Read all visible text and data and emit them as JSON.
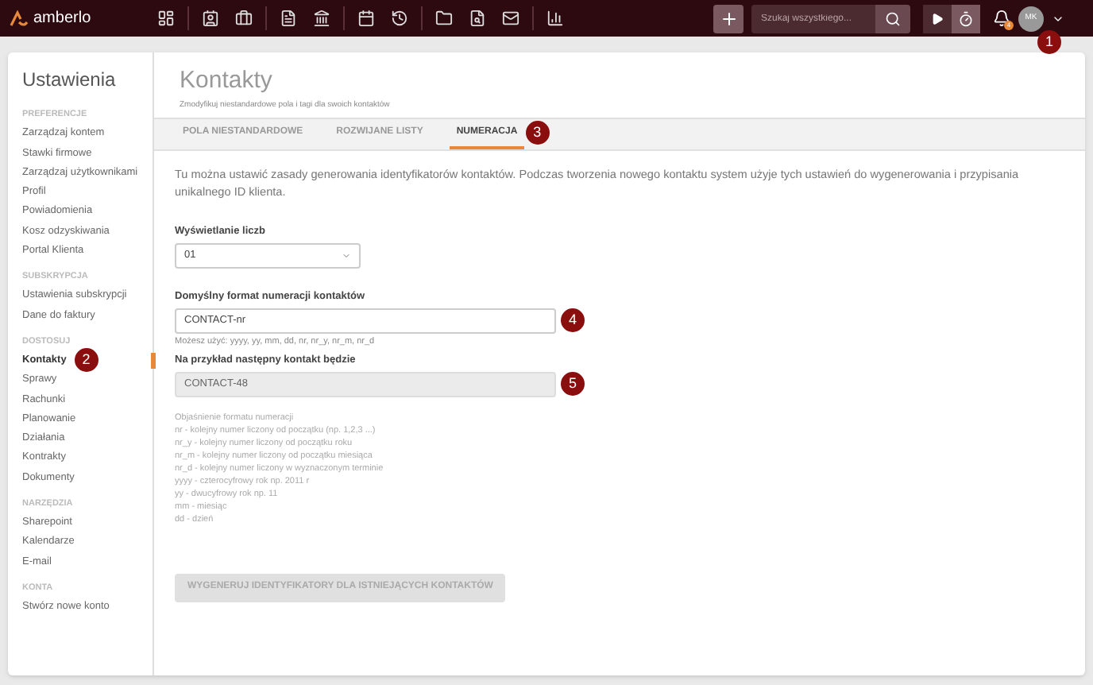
{
  "topbar": {
    "logo": "amberlo",
    "search": {
      "placeholder": "Szukaj wszystkiego..."
    },
    "notifications": "4",
    "avatar": "MK",
    "marker": "1"
  },
  "sidebar": {
    "title": "Ustawienia",
    "sections": [
      {
        "heading": "PREFERENCJE",
        "items": [
          {
            "label": "Zarządzaj kontem",
            "selected": false
          },
          {
            "label": "Stawki firmowe",
            "selected": false
          },
          {
            "label": "Zarządzaj użytkownikami",
            "selected": false
          },
          {
            "label": "Profil",
            "selected": false
          },
          {
            "label": "Powiadomienia",
            "selected": false
          },
          {
            "label": "Kosz odzyskiwania",
            "selected": false
          },
          {
            "label": "Portal Klienta",
            "selected": false
          }
        ]
      },
      {
        "heading": "SUBSKRYPCJA",
        "items": [
          {
            "label": "Ustawienia subskrypcji",
            "selected": false
          },
          {
            "label": "Dane do faktury",
            "selected": false
          }
        ]
      },
      {
        "heading": "DOSTOSUJ",
        "items": [
          {
            "label": "Kontakty",
            "selected": true,
            "marker": "2"
          },
          {
            "label": "Sprawy",
            "selected": false
          },
          {
            "label": "Rachunki",
            "selected": false
          },
          {
            "label": "Planowanie",
            "selected": false
          },
          {
            "label": "Działania",
            "selected": false
          },
          {
            "label": "Kontrakty",
            "selected": false
          },
          {
            "label": "Dokumenty",
            "selected": false
          }
        ]
      },
      {
        "heading": "NARZĘDZIA",
        "items": [
          {
            "label": "Sharepoint",
            "selected": false
          },
          {
            "label": "Kalendarze",
            "selected": false
          },
          {
            "label": "E-mail",
            "selected": false
          }
        ]
      },
      {
        "heading": "KONTA",
        "items": [
          {
            "label": "Stwórz nowe konto",
            "selected": false
          }
        ]
      }
    ]
  },
  "page": {
    "title": "Kontakty",
    "subtitle": "Zmodyfikuj niestandardowe pola i tagi dla swoich kontaktów",
    "tabs": [
      {
        "label": "POLA NIESTANDARDOWE",
        "selected": false
      },
      {
        "label": "ROZWIJANE LISTY",
        "selected": false
      },
      {
        "label": "NUMERACJA",
        "selected": true,
        "marker": "3"
      }
    ],
    "intro": "Tu można ustawić zasady generowania identyfikatorów kontaktów. Podczas tworzenia nowego kontaktu system użyje tych ustawień do wygenerowania i przypisania unikalnego ID klienta.",
    "display": {
      "label": "Wyświetlanie liczb",
      "value": "01"
    },
    "format": {
      "label": "Domyślny format numeracji kontaktów",
      "value": "CONTACT-nr",
      "hint": "Możesz użyć: yyyy, yy, mm, dd, nr, nr_y, nr_m, nr_d",
      "marker": "4"
    },
    "example": {
      "label": "Na przykład następny kontakt będzie",
      "value": "CONTACT-48",
      "marker": "5"
    },
    "legend": [
      "Objaśnienie formatu numeracji",
      "nr - kolejny numer liczony od początku (np. 1,2,3 ...)",
      "nr_y - kolejny numer liczony od początku roku",
      "nr_m - kolejny numer liczony od początku miesiąca",
      "nr_d - kolejny numer liczony w wyznaczonym terminie",
      "yyyy - czterocyfrowy rok np. 2011 r",
      "yy - dwucyfrowy rok np. 11",
      "mm - miesiąc",
      "dd - dzień"
    ],
    "button": {
      "label": "WYGENERUJ IDENTYFIKATORY DLA ISTNIEJĄCYCH KONTAKTÓW",
      "disabled": true
    }
  }
}
